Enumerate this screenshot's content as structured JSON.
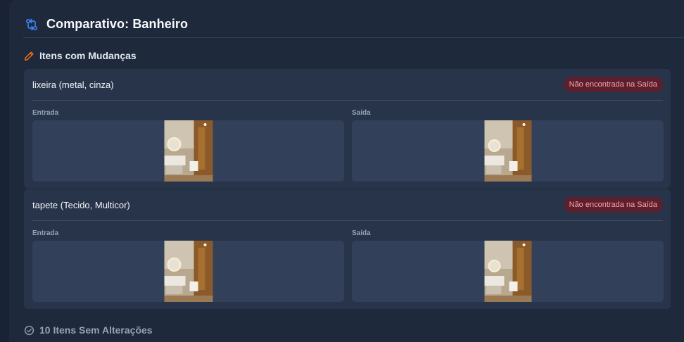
{
  "header": {
    "title": "Comparativo: Banheiro",
    "icon": "compare-arrows-icon",
    "accent": "#3b82f6"
  },
  "changes_section": {
    "title": "Itens com Mudanças",
    "icon": "pencil-icon",
    "accent": "#f97316"
  },
  "items": [
    {
      "name": "lixeira (metal, cinza)",
      "status": "Não encontrada na Saída",
      "entrada_label": "Entrada",
      "saida_label": "Saída"
    },
    {
      "name": "tapete (Tecido, Multicor)",
      "status": "Não encontrada na Saída",
      "entrada_label": "Entrada",
      "saida_label": "Saída"
    }
  ],
  "unchanged_section": {
    "title": "10 Itens Sem Alterações",
    "icon": "check-circle-icon"
  },
  "colors": {
    "badge_bg": "#5b1f2e",
    "badge_text": "#fca5a5",
    "card_bg": "#273449",
    "panel_bg": "#1e293b"
  }
}
